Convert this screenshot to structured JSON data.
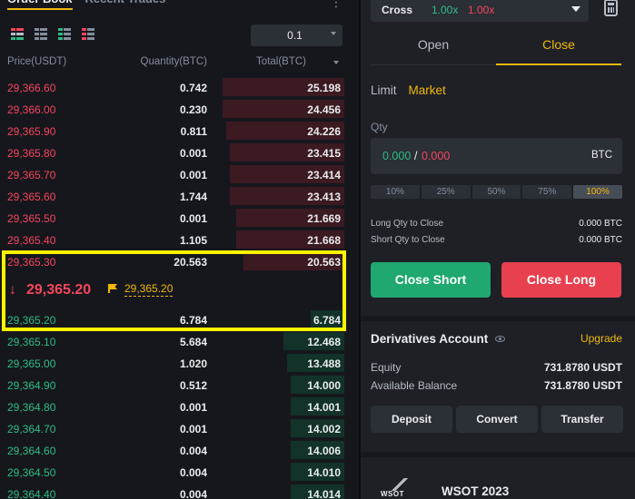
{
  "order_book": {
    "tabs": [
      "Order Book",
      "Recent Trades"
    ],
    "tick_size": "0.1",
    "headers": {
      "price": "Price(USDT)",
      "quantity": "Quantity(BTC)",
      "total": "Total(BTC)"
    },
    "asks": [
      {
        "price": "29,366.60",
        "qty": "0.742",
        "total": "25.198",
        "depth": 0.36
      },
      {
        "price": "29,366.00",
        "qty": "0.230",
        "total": "24.456",
        "depth": 0.36
      },
      {
        "price": "29,365.90",
        "qty": "0.811",
        "total": "24.226",
        "depth": 0.35
      },
      {
        "price": "29,365.80",
        "qty": "0.001",
        "total": "23.415",
        "depth": 0.34
      },
      {
        "price": "29,365.70",
        "qty": "0.001",
        "total": "23.414",
        "depth": 0.34
      },
      {
        "price": "29,365.60",
        "qty": "1.744",
        "total": "23.413",
        "depth": 0.34
      },
      {
        "price": "29,365.50",
        "qty": "0.001",
        "total": "21.669",
        "depth": 0.32
      },
      {
        "price": "29,365.40",
        "qty": "1.105",
        "total": "21.668",
        "depth": 0.32
      },
      {
        "price": "29,365.30",
        "qty": "20.563",
        "total": "20.563",
        "depth": 0.3
      }
    ],
    "last_price": "29,365.20",
    "mark_price": "29,365.20",
    "bids": [
      {
        "price": "29,365.20",
        "qty": "6.784",
        "total": "6.784",
        "depth": 0.1
      },
      {
        "price": "29,365.10",
        "qty": "5.684",
        "total": "12.468",
        "depth": 0.18
      },
      {
        "price": "29,365.00",
        "qty": "1.020",
        "total": "13.488",
        "depth": 0.17
      },
      {
        "price": "29,364.90",
        "qty": "0.512",
        "total": "14.000",
        "depth": 0.16
      },
      {
        "price": "29,364.80",
        "qty": "0.001",
        "total": "14.001",
        "depth": 0.16
      },
      {
        "price": "29,364.70",
        "qty": "0.001",
        "total": "14.002",
        "depth": 0.16
      },
      {
        "price": "29,364.60",
        "qty": "0.004",
        "total": "14.006",
        "depth": 0.16
      },
      {
        "price": "29,364.50",
        "qty": "0.004",
        "total": "14.010",
        "depth": 0.16
      },
      {
        "price": "29,364.40",
        "qty": "0.004",
        "total": "14.014",
        "depth": 0.16
      }
    ]
  },
  "trade_panel": {
    "margin_mode": "Cross",
    "leverage_long": "1.00x",
    "leverage_short": "1.00x",
    "tabs": {
      "open": "Open",
      "close": "Close"
    },
    "order_types": {
      "limit": "Limit",
      "market": "Market"
    },
    "qty_label": "Qty",
    "qty_long": "0.000",
    "qty_sep": "/",
    "qty_short": "0.000",
    "qty_unit": "BTC",
    "percentages": [
      "10%",
      "25%",
      "50%",
      "75%",
      "100%"
    ],
    "long_qty_label": "Long Qty to Close",
    "long_qty_value": "0.000 BTC",
    "short_qty_label": "Short Qty to Close",
    "short_qty_value": "0.000 BTC",
    "close_short": "Close Short",
    "close_long": "Close Long"
  },
  "account": {
    "title": "Derivatives Account",
    "upgrade": "Upgrade",
    "equity_label": "Equity",
    "equity_value": "731.8780 USDT",
    "balance_label": "Available Balance",
    "balance_value": "731.8780 USDT",
    "deposit": "Deposit",
    "convert": "Convert",
    "transfer": "Transfer"
  },
  "promo": {
    "logo_text": "WSOT",
    "title": "WSOT 2023"
  },
  "colors": {
    "ask": "#f6465d",
    "bid": "#2ebd85",
    "accent": "#f0b90b",
    "highlight": "#fcf500"
  }
}
